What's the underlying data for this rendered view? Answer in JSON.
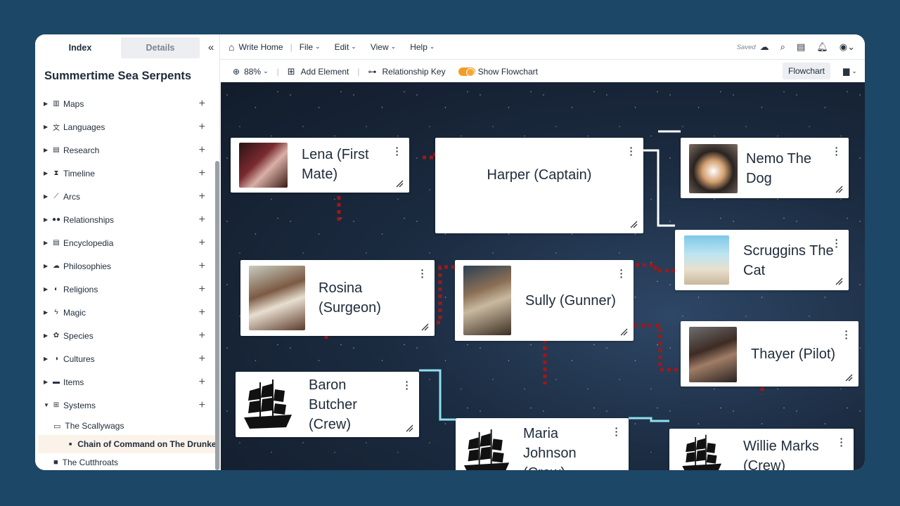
{
  "sidebar": {
    "tabs": {
      "index": "Index",
      "details": "Details"
    },
    "project_title": "Summertime Sea Serpents",
    "items": [
      {
        "label": "Maps",
        "icon": "map-icon"
      },
      {
        "label": "Languages",
        "icon": "translate-icon"
      },
      {
        "label": "Research",
        "icon": "document-icon"
      },
      {
        "label": "Timeline",
        "icon": "hourglass-icon"
      },
      {
        "label": "Arcs",
        "icon": "chart-line-icon"
      },
      {
        "label": "Relationships",
        "icon": "people-icon"
      },
      {
        "label": "Encyclopedia",
        "icon": "book-icon"
      },
      {
        "label": "Philosophies",
        "icon": "cloud-icon"
      },
      {
        "label": "Religions",
        "icon": "yin-yang-icon"
      },
      {
        "label": "Magic",
        "icon": "bolt-icon"
      },
      {
        "label": "Species",
        "icon": "paw-icon"
      },
      {
        "label": "Cultures",
        "icon": "mask-icon"
      },
      {
        "label": "Items",
        "icon": "item-icon"
      },
      {
        "label": "Systems",
        "icon": "flowchart-icon"
      }
    ],
    "sub_items": {
      "scallywags": "The Scallywags",
      "active_doc": "Chain of Command on The Drunken Siren",
      "cutthroats": "The Cutthroats"
    }
  },
  "topbar": {
    "home": "Write Home",
    "file": "File",
    "edit": "Edit",
    "view": "View",
    "help": "Help",
    "saved": "Saved"
  },
  "toolbar": {
    "zoom": "88%",
    "add_element": "Add Element",
    "relationship_key": "Relationship Key",
    "show_flowchart": "Show Flowchart",
    "flowchart": "Flowchart"
  },
  "cards": {
    "lena": "Lena (First Mate)",
    "harper": "Harper (Captain)",
    "nemo": "Nemo The Dog",
    "scruggins": "Scruggins The Cat",
    "rosina": "Rosina (Surgeon)",
    "sully": "Sully (Gunner)",
    "thayer": "Thayer (Pilot)",
    "baron": "Baron Butcher (Crew)",
    "maria": "Maria Johnson (Crew)",
    "willie": "Willie Marks (Crew)"
  },
  "colors": {
    "background": "#1c4766",
    "accent_orange": "#f39c27",
    "link_red": "#a01818",
    "link_white": "#ffffff",
    "link_cyan": "#8fe0f0"
  }
}
